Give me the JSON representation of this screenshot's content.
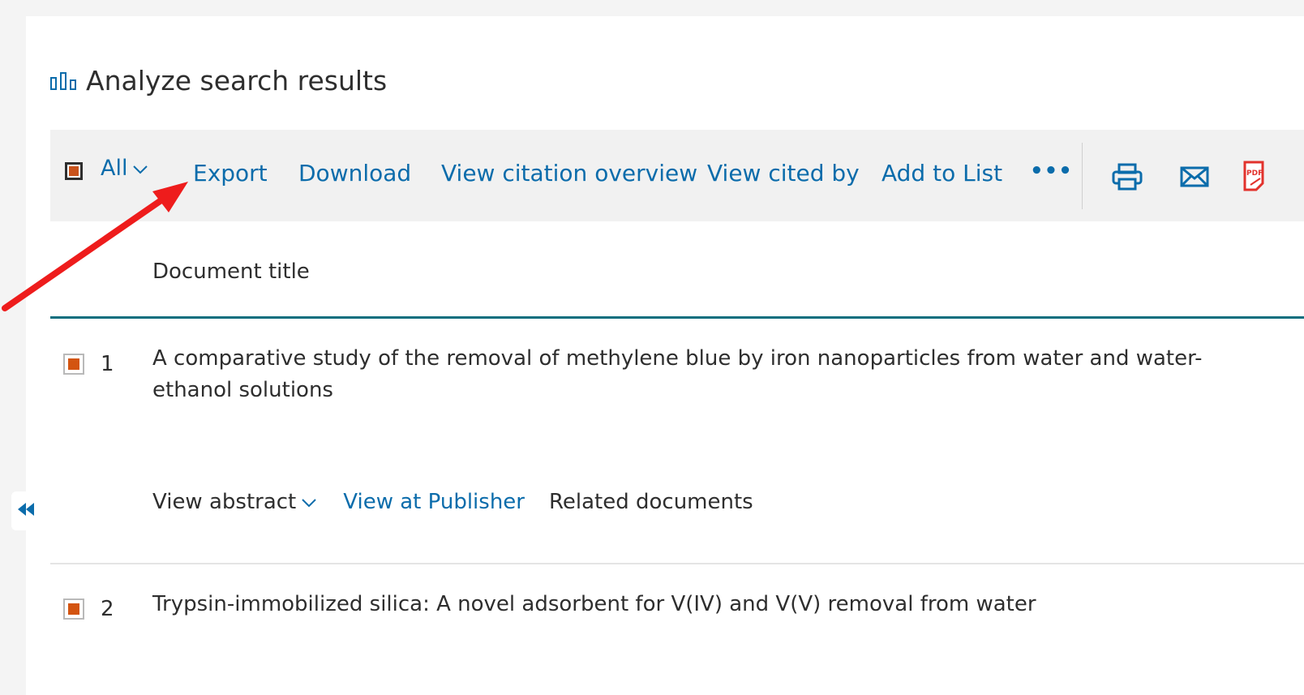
{
  "header": {
    "title": "Analyze search results",
    "icon": "bar-chart-icon"
  },
  "toolbar": {
    "select_all_label": "All",
    "actions": [
      "Export",
      "Download",
      "View citation overview",
      "View cited by",
      "Add to List"
    ],
    "more_label": "•••",
    "icons": [
      "print-icon",
      "email-icon",
      "pdf-icon"
    ]
  },
  "table": {
    "column_header": "Document title"
  },
  "results": [
    {
      "number": "1",
      "title": "A comparative study of the removal of methylene blue by iron nanoparticles from water and water-ethanol solutions",
      "actions": {
        "abstract": "View abstract",
        "publisher": "View at Publisher",
        "related": "Related documents"
      }
    },
    {
      "number": "2",
      "title": "Trypsin-immobilized silica: A novel adsorbent for V(IV) and V(V) removal from water"
    }
  ],
  "colors": {
    "link": "#0b6cab",
    "accent": "#d35410",
    "rule": "#0b6e7e",
    "annotation_arrow": "#ee1c1c"
  }
}
